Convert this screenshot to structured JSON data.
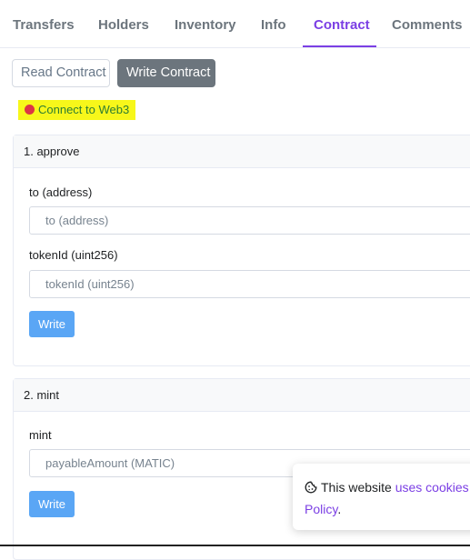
{
  "tabs": [
    {
      "label": "Transfers",
      "active": false
    },
    {
      "label": "Holders",
      "active": false
    },
    {
      "label": "Inventory",
      "active": false
    },
    {
      "label": "Info",
      "active": false
    },
    {
      "label": "Contract",
      "active": true
    },
    {
      "label": "Comments",
      "active": false
    }
  ],
  "contract_buttons": {
    "read": "Read Contract",
    "write": "Write Contract"
  },
  "connect": {
    "label": "Connect to Web3",
    "status_color": "#dc3545",
    "highlight": "#f7f71a"
  },
  "functions": [
    {
      "title": "1. approve",
      "inputs": [
        {
          "label": "to (address)",
          "placeholder": "to (address)"
        },
        {
          "label": "tokenId (uint256)",
          "placeholder": "tokenId (uint256)"
        }
      ],
      "button": "Write"
    },
    {
      "title": "2. mint",
      "inputs": [
        {
          "label": "mint",
          "placeholder": "payableAmount (MATIC)"
        }
      ],
      "button": "Write"
    }
  ],
  "cookie": {
    "icon": "cookie-icon",
    "text_before": "This website ",
    "link1": "uses cookies",
    "link2": "Policy",
    "text_after": "."
  },
  "colors": {
    "accent": "#7b3fe4",
    "write_button": "#5aa6f5",
    "secondary": "#6c757d"
  }
}
